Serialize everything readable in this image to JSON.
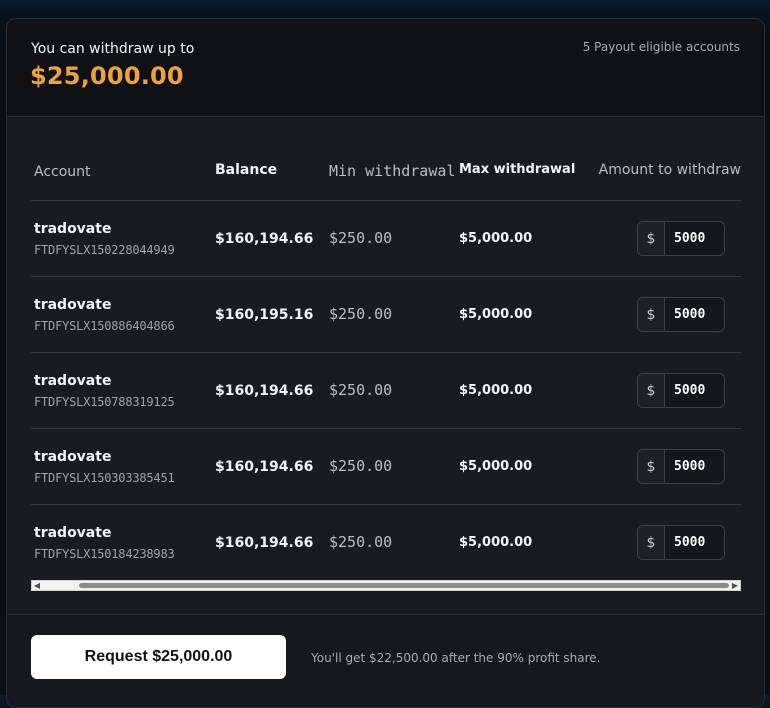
{
  "summary": {
    "label": "You can withdraw up to",
    "amount": "$25,000.00",
    "eligible": "5 Payout eligible accounts"
  },
  "table": {
    "headers": [
      "Account",
      "Balance",
      "Min withdrawal",
      "Max withdrawal",
      "Amount to withdraw"
    ],
    "rows": [
      {
        "name": "tradovate",
        "id": "FTDFYSLX150228044949",
        "balance": "$160,194.66",
        "min": "$250.00",
        "max": "$5,000.00",
        "currency": "$",
        "amount": "5000"
      },
      {
        "name": "tradovate",
        "id": "FTDFYSLX150886404866",
        "balance": "$160,195.16",
        "min": "$250.00",
        "max": "$5,000.00",
        "currency": "$",
        "amount": "5000"
      },
      {
        "name": "tradovate",
        "id": "FTDFYSLX150788319125",
        "balance": "$160,194.66",
        "min": "$250.00",
        "max": "$5,000.00",
        "currency": "$",
        "amount": "5000"
      },
      {
        "name": "tradovate",
        "id": "FTDFYSLX150303385451",
        "balance": "$160,194.66",
        "min": "$250.00",
        "max": "$5,000.00",
        "currency": "$",
        "amount": "5000"
      },
      {
        "name": "tradovate",
        "id": "FTDFYSLX150184238983",
        "balance": "$160,194.66",
        "min": "$250.00",
        "max": "$5,000.00",
        "currency": "$",
        "amount": "5000"
      }
    ]
  },
  "scrollbar": {
    "left_arrow": "◀",
    "right_arrow": "▶"
  },
  "footer": {
    "button_label": "Request $25,000.00",
    "note": "You'll get $22,500.00 after the 90% profit share."
  },
  "colors": {
    "accent": "#eda23e",
    "background": "#181b20",
    "button": "#ffffff"
  }
}
